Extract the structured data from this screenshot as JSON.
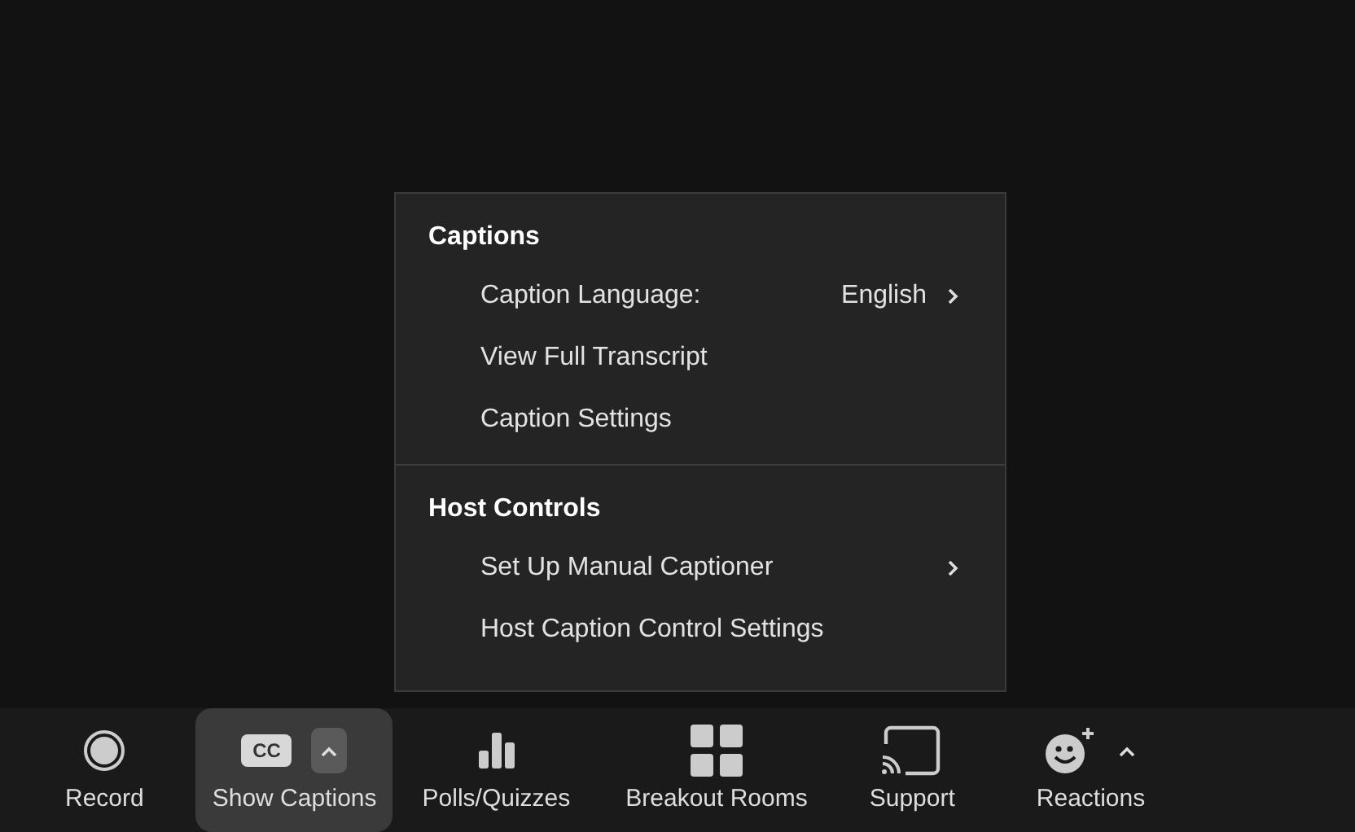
{
  "caption_menu": {
    "sections": [
      {
        "title": "Captions",
        "items": [
          {
            "label": "Caption Language:",
            "value": "English",
            "submenu": true
          },
          {
            "label": "View Full Transcript",
            "submenu": false
          },
          {
            "label": "Caption Settings",
            "submenu": false
          }
        ]
      },
      {
        "title": "Host Controls",
        "items": [
          {
            "label": "Set Up Manual Captioner",
            "submenu": true
          },
          {
            "label": "Host Caption Control Settings",
            "submenu": false
          }
        ]
      }
    ]
  },
  "toolbar": [
    {
      "kind": "record",
      "label": "Record",
      "selected": false,
      "menu": false
    },
    {
      "kind": "captions",
      "label": "Show Captions",
      "badge": "CC",
      "selected": true,
      "menu": true
    },
    {
      "kind": "polls",
      "label": "Polls/Quizzes",
      "selected": false,
      "menu": false
    },
    {
      "kind": "breakout",
      "label": "Breakout Rooms",
      "selected": false,
      "menu": false
    },
    {
      "kind": "support",
      "label": "Support",
      "selected": false,
      "menu": false
    },
    {
      "kind": "reactions",
      "label": "Reactions",
      "selected": false,
      "menu": true
    }
  ]
}
